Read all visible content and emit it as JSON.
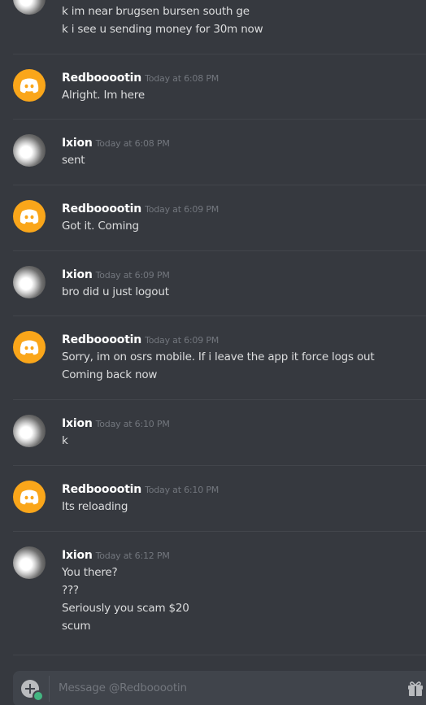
{
  "messages": [
    {
      "author": "",
      "time": "",
      "avatar": "cat",
      "lines": [
        "k im near brugsen bursen south ge",
        "k i see u sending money for 30m now"
      ],
      "continuation": true
    },
    {
      "author": "Redbooootin",
      "time": "Today at 6:08 PM",
      "avatar": "discord-icon",
      "lines": [
        "Alright. Im here"
      ]
    },
    {
      "author": "Ixion",
      "time": "Today at 6:08 PM",
      "avatar": "cat",
      "lines": [
        "sent"
      ]
    },
    {
      "author": "Redbooootin",
      "time": "Today at 6:09 PM",
      "avatar": "discord-icon",
      "lines": [
        "Got it. Coming"
      ]
    },
    {
      "author": "Ixion",
      "time": "Today at 6:09 PM",
      "avatar": "cat",
      "lines": [
        "bro did u just logout"
      ]
    },
    {
      "author": "Redbooootin",
      "time": "Today at 6:09 PM",
      "avatar": "discord-icon",
      "lines": [
        "Sorry, im on osrs mobile. If i leave the app it force logs out",
        "Coming back now"
      ]
    },
    {
      "author": "Ixion",
      "time": "Today at 6:10 PM",
      "avatar": "cat",
      "lines": [
        "k"
      ]
    },
    {
      "author": "Redbooootin",
      "time": "Today at 6:10 PM",
      "avatar": "discord-icon",
      "lines": [
        "Its reloading"
      ]
    },
    {
      "author": "Ixion",
      "time": "Today at 6:12 PM",
      "avatar": "cat",
      "lines": [
        "You there?",
        "???",
        "Seriously you scam $20",
        "scum"
      ]
    }
  ],
  "composer": {
    "placeholder": "Message @Redbooootin",
    "attach_icon": "plus-circle-icon",
    "gift_icon": "gift-icon"
  },
  "colors": {
    "background": "#36393f",
    "composer": "#40444b",
    "discord_avatar": "#faa61a",
    "username": "#ffffff",
    "text": "#dcddde",
    "timestamp": "#72767d"
  }
}
